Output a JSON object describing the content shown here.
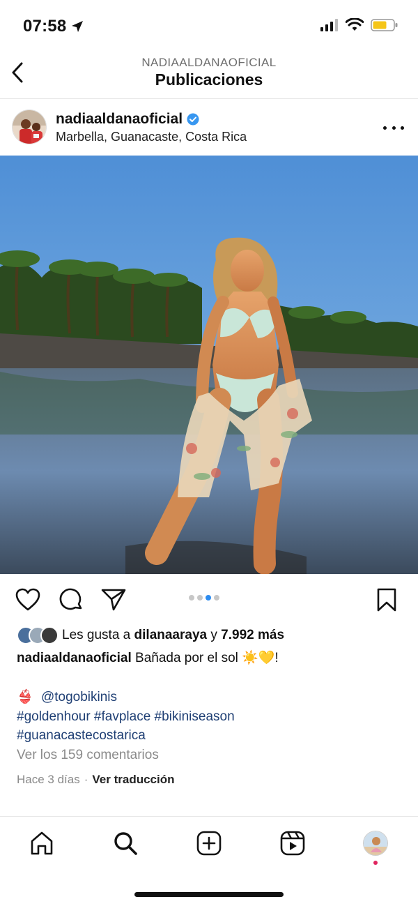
{
  "status_bar": {
    "time": "07:58",
    "icons": [
      "location-arrow-icon",
      "signal-icon",
      "wifi-icon",
      "battery-icon"
    ],
    "battery_color": "#f5c518"
  },
  "nav": {
    "subtitle": "NADIAALDANAOFICIAL",
    "title": "Publicaciones",
    "back_icon": "chevron-left-icon"
  },
  "post": {
    "username": "nadiaaldanaoficial",
    "verified": true,
    "location": "Marbella, Guanacaste, Costa Rica",
    "more_icon": "more-horizontal-icon",
    "image_description_icon": "photo",
    "carousel": {
      "count": 4,
      "active_index": 2
    }
  },
  "actions": {
    "like_icon": "heart-icon",
    "comment_icon": "comment-icon",
    "share_icon": "send-icon",
    "save_icon": "bookmark-icon"
  },
  "likes": {
    "prefix": "Les gusta a",
    "user": "dilanaaraya",
    "connector": "y",
    "count": "7.992 más"
  },
  "caption": {
    "username": "nadiaaldanaoficial",
    "text": "Bañada por el sol ☀️💛!",
    "line_emoji": "👙",
    "mention": "@togobikinis",
    "hashtags_line1": "#goldenhour #favplace #bikiniseason",
    "hashtags_line2": "#guanacastecostarica"
  },
  "comments": {
    "view_all": "Ver los 159 comentarios"
  },
  "meta": {
    "time_ago": "Hace 3 días",
    "separator": "·",
    "translate": "Ver traducción"
  },
  "tab_bar": {
    "items": [
      "home-icon",
      "search-icon",
      "create-post-icon",
      "reels-icon",
      "profile-avatar"
    ],
    "notification_color": "#e0245e"
  },
  "colors": {
    "link": "#1f3f74",
    "verified": "#3897f0",
    "carousel_active": "#2d8cf0",
    "muted_text": "#8a8a8a"
  }
}
